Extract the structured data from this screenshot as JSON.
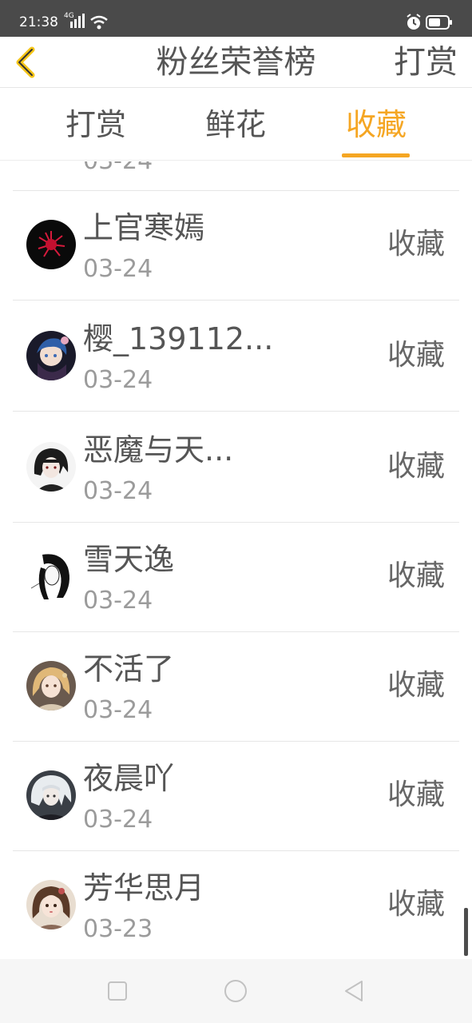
{
  "status": {
    "time": "21:38",
    "network": "4G"
  },
  "header": {
    "title": "粉丝荣誉榜",
    "action": "打赏"
  },
  "tabs": [
    {
      "label": "打赏",
      "active": false
    },
    {
      "label": "鲜花",
      "active": false
    },
    {
      "label": "收藏",
      "active": true
    }
  ],
  "colors": {
    "accent": "#f5a623",
    "status_bar": "#4a4a4a",
    "text_primary": "#555555",
    "text_secondary": "#9b9b9b"
  },
  "partial_item": {
    "date": "03-24"
  },
  "list": [
    {
      "name": "上官寒嫣",
      "date": "03-24",
      "action": "收藏",
      "avatar": "red-flower-avatar"
    },
    {
      "name": "樱_139112...",
      "date": "03-24",
      "action": "收藏",
      "avatar": "anime-boy-avatar"
    },
    {
      "name": "恶魔与天...",
      "date": "03-24",
      "action": "收藏",
      "avatar": "dark-hair-avatar"
    },
    {
      "name": "雪天逸",
      "date": "03-24",
      "action": "收藏",
      "avatar": "monochrome-avatar"
    },
    {
      "name": "不活了",
      "date": "03-24",
      "action": "收藏",
      "avatar": "blonde-girl-avatar"
    },
    {
      "name": "夜晨吖",
      "date": "03-24",
      "action": "收藏",
      "avatar": "white-hair-avatar"
    },
    {
      "name": "芳华思月",
      "date": "03-23",
      "action": "收藏",
      "avatar": "brown-hair-girl-avatar"
    }
  ]
}
